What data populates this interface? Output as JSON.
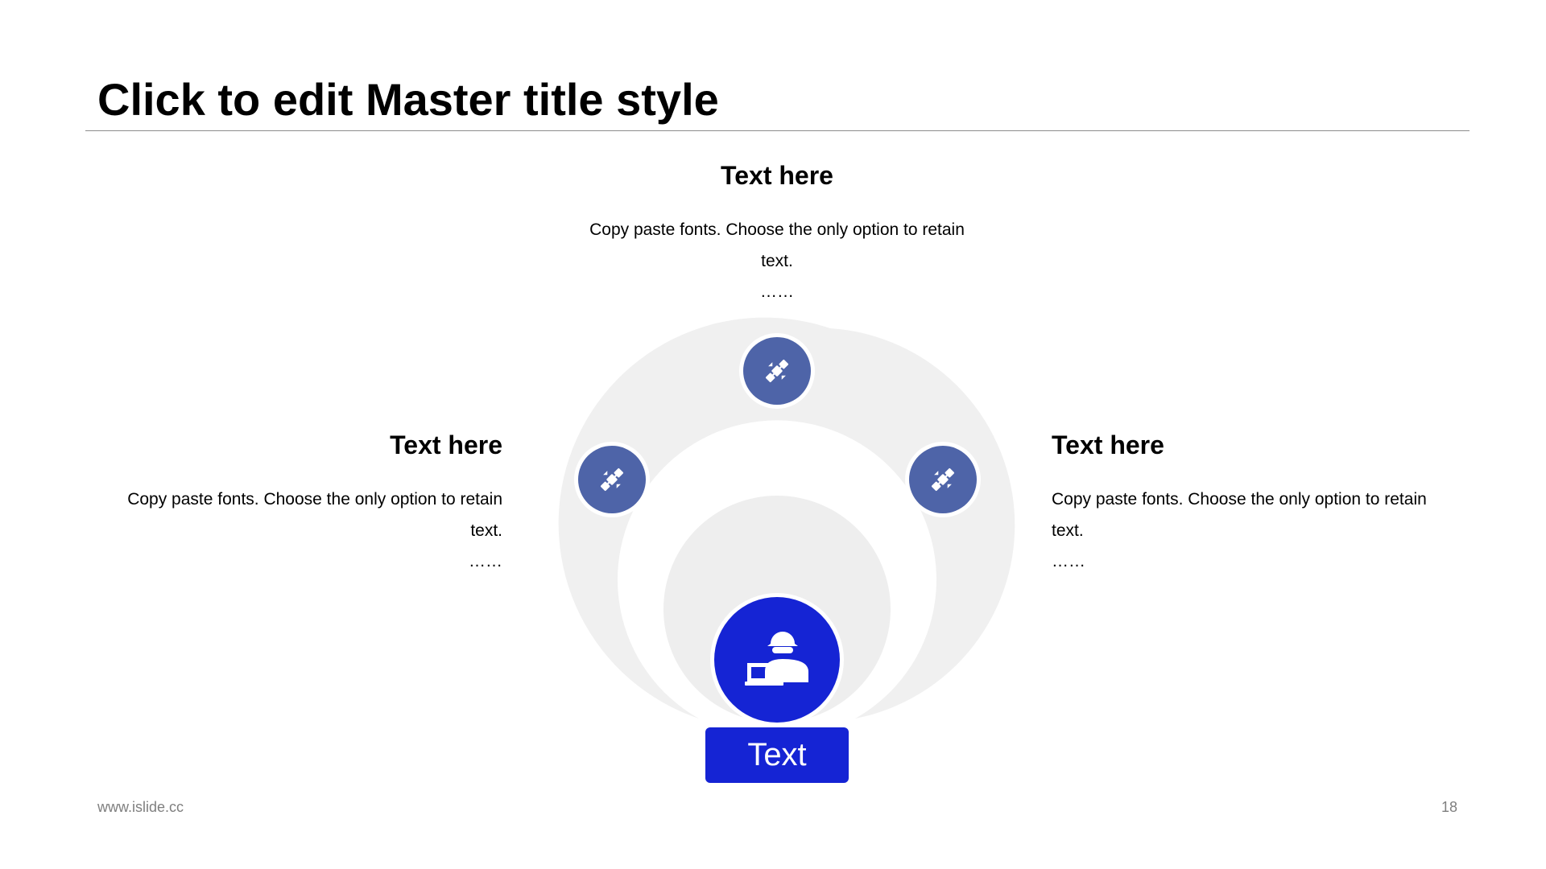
{
  "slide": {
    "title": "Click to edit Master title style",
    "footer_url": "www.islide.cc",
    "page_number": "18"
  },
  "blocks": {
    "top": {
      "heading": "Text here",
      "body": "Copy paste fonts. Choose the only option to retain text.",
      "ellipsis": "……"
    },
    "left": {
      "heading": "Text here",
      "body": "Copy paste fonts. Choose the only option to retain text.",
      "ellipsis": "……"
    },
    "right": {
      "heading": "Text here",
      "body": "Copy paste fonts. Choose the only option to retain text.",
      "ellipsis": "……"
    }
  },
  "center": {
    "label": "Text",
    "icon": "person-laptop-icon"
  },
  "nodes": [
    {
      "icon": "satellite-icon"
    },
    {
      "icon": "satellite-icon"
    },
    {
      "icon": "satellite-icon"
    }
  ],
  "colors": {
    "node_fill": "#4e64a8",
    "center_fill": "#1524d4",
    "arc_fill": "#f0f0f0",
    "inner_disc": "#eeeeee"
  }
}
